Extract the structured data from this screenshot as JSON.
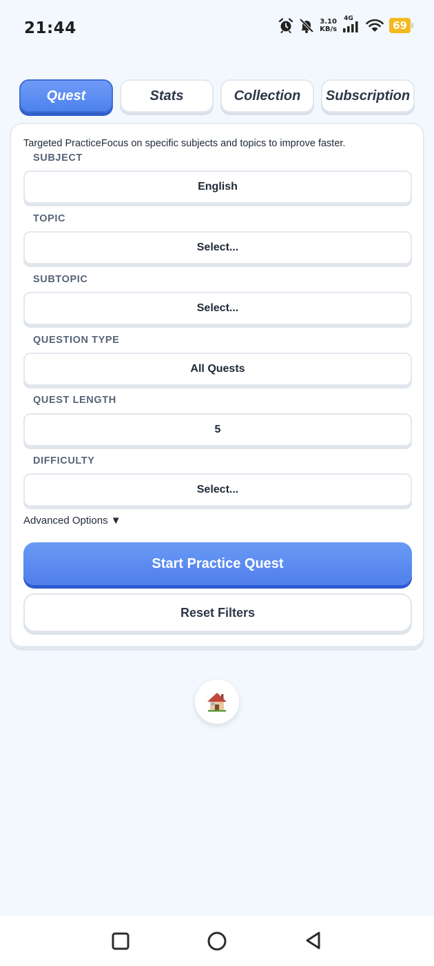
{
  "status_bar": {
    "time": "21:44",
    "net_speed_value": "3.10",
    "net_speed_unit": "KB/s",
    "network_type": "4G",
    "battery": "69",
    "icons": [
      "alarm-icon",
      "bell-off-icon",
      "signal-icon",
      "wifi-icon",
      "battery-icon"
    ]
  },
  "tabs": [
    {
      "label": "Quest",
      "active": true
    },
    {
      "label": "Stats",
      "active": false
    },
    {
      "label": "Collection",
      "active": false
    },
    {
      "label": "Subscription",
      "active": false
    }
  ],
  "practice": {
    "intro": "Targeted PracticeFocus on specific subjects and topics to improve faster.",
    "fields": [
      {
        "label": "SUBJECT",
        "value": "English"
      },
      {
        "label": "TOPIC",
        "value": "Select..."
      },
      {
        "label": "SUBTOPIC",
        "value": "Select..."
      },
      {
        "label": "QUESTION TYPE",
        "value": "All Quests"
      },
      {
        "label": "QUEST LENGTH",
        "value": "5"
      },
      {
        "label": "DIFFICULTY",
        "value": "Select..."
      }
    ],
    "advanced_options": "Advanced Options ▼",
    "start_label": "Start Practice Quest",
    "reset_label": "Reset Filters"
  },
  "home_icon": "🏠",
  "colors": {
    "accent": "#5b8cf1",
    "accent_dark": "#2d5ad0",
    "background": "#f3f8fe",
    "battery": "#f5b81e"
  },
  "nav_bar": {
    "buttons": [
      "recent-apps-button",
      "home-nav-button",
      "back-button"
    ]
  }
}
